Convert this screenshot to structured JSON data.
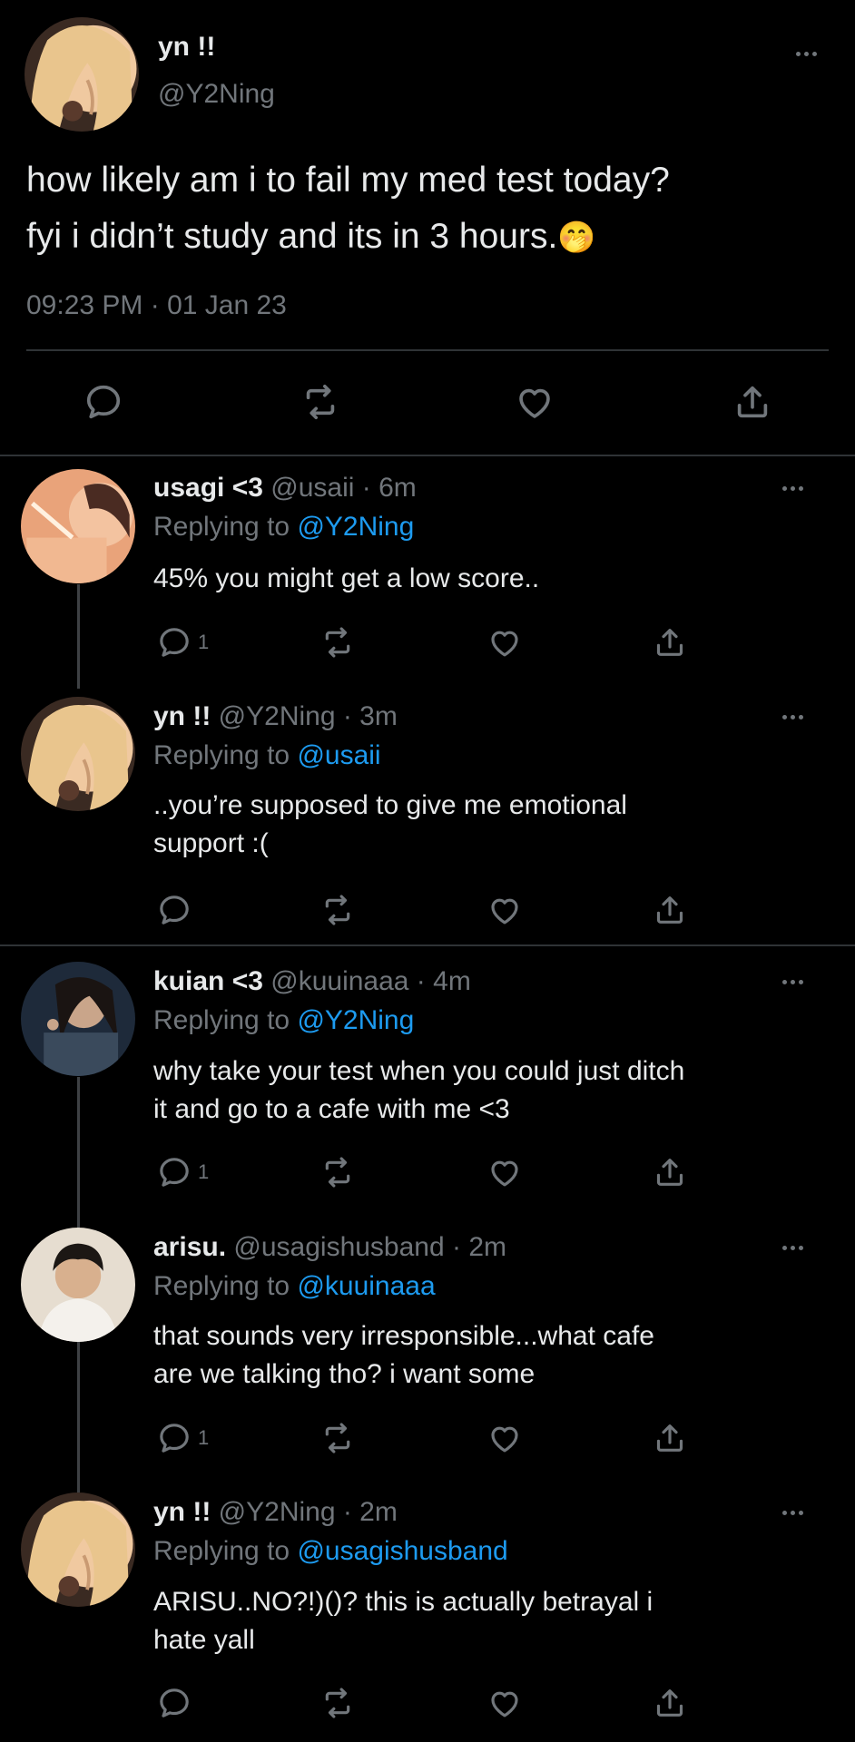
{
  "main_tweet": {
    "display_name": "yn !!",
    "handle": "@Y2Ning",
    "text_line1": "how likely am i to fail my med test today?",
    "text_line2": "fyi i didn’t study and its in 3 hours.",
    "emoji": "🤭",
    "timestamp": "09:23 PM · 01 Jan 23"
  },
  "replies": [
    {
      "display_name": "usagi <3",
      "meta": "@usaii · 6m",
      "replying_prefix": "Replying to ",
      "replying_to": "@Y2Ning",
      "line1": "45% you might get a low score..",
      "line2": "",
      "reply_count": "1"
    },
    {
      "display_name": "yn !!",
      "meta": "@Y2Ning · 3m",
      "replying_prefix": "Replying to ",
      "replying_to": "@usaii",
      "line1": "..you’re supposed to give me emotional",
      "line2": "support :(",
      "reply_count": ""
    },
    {
      "display_name": "kuian <3",
      "meta": "@kuuinaaa · 4m",
      "replying_prefix": "Replying to ",
      "replying_to": "@Y2Ning",
      "line1": "why take your test when you could just ditch",
      "line2": "it and go to a cafe with me <3",
      "reply_count": "1"
    },
    {
      "display_name": "arisu.",
      "meta": "@usagishusband · 2m",
      "replying_prefix": "Replying to ",
      "replying_to": "@kuuinaaa",
      "line1": "that sounds very irresponsible...what cafe",
      "line2": "are we talking tho? i want some",
      "reply_count": "1"
    },
    {
      "display_name": "yn !!",
      "meta": "@Y2Ning · 2m",
      "replying_prefix": "Replying to ",
      "replying_to": "@usagishusband",
      "line1": "ARISU..NO?!)()? this is actually betrayal i",
      "line2": "hate yall",
      "reply_count": ""
    }
  ],
  "icons": {
    "reply": "reply-icon",
    "retweet": "retweet-icon",
    "like": "heart-icon",
    "share": "share-icon",
    "more": "more-icon"
  },
  "colors": {
    "background": "#000000",
    "text": "#e7e9ea",
    "muted": "#71767b",
    "link": "#1d9bf0",
    "divider": "#2f3336"
  }
}
